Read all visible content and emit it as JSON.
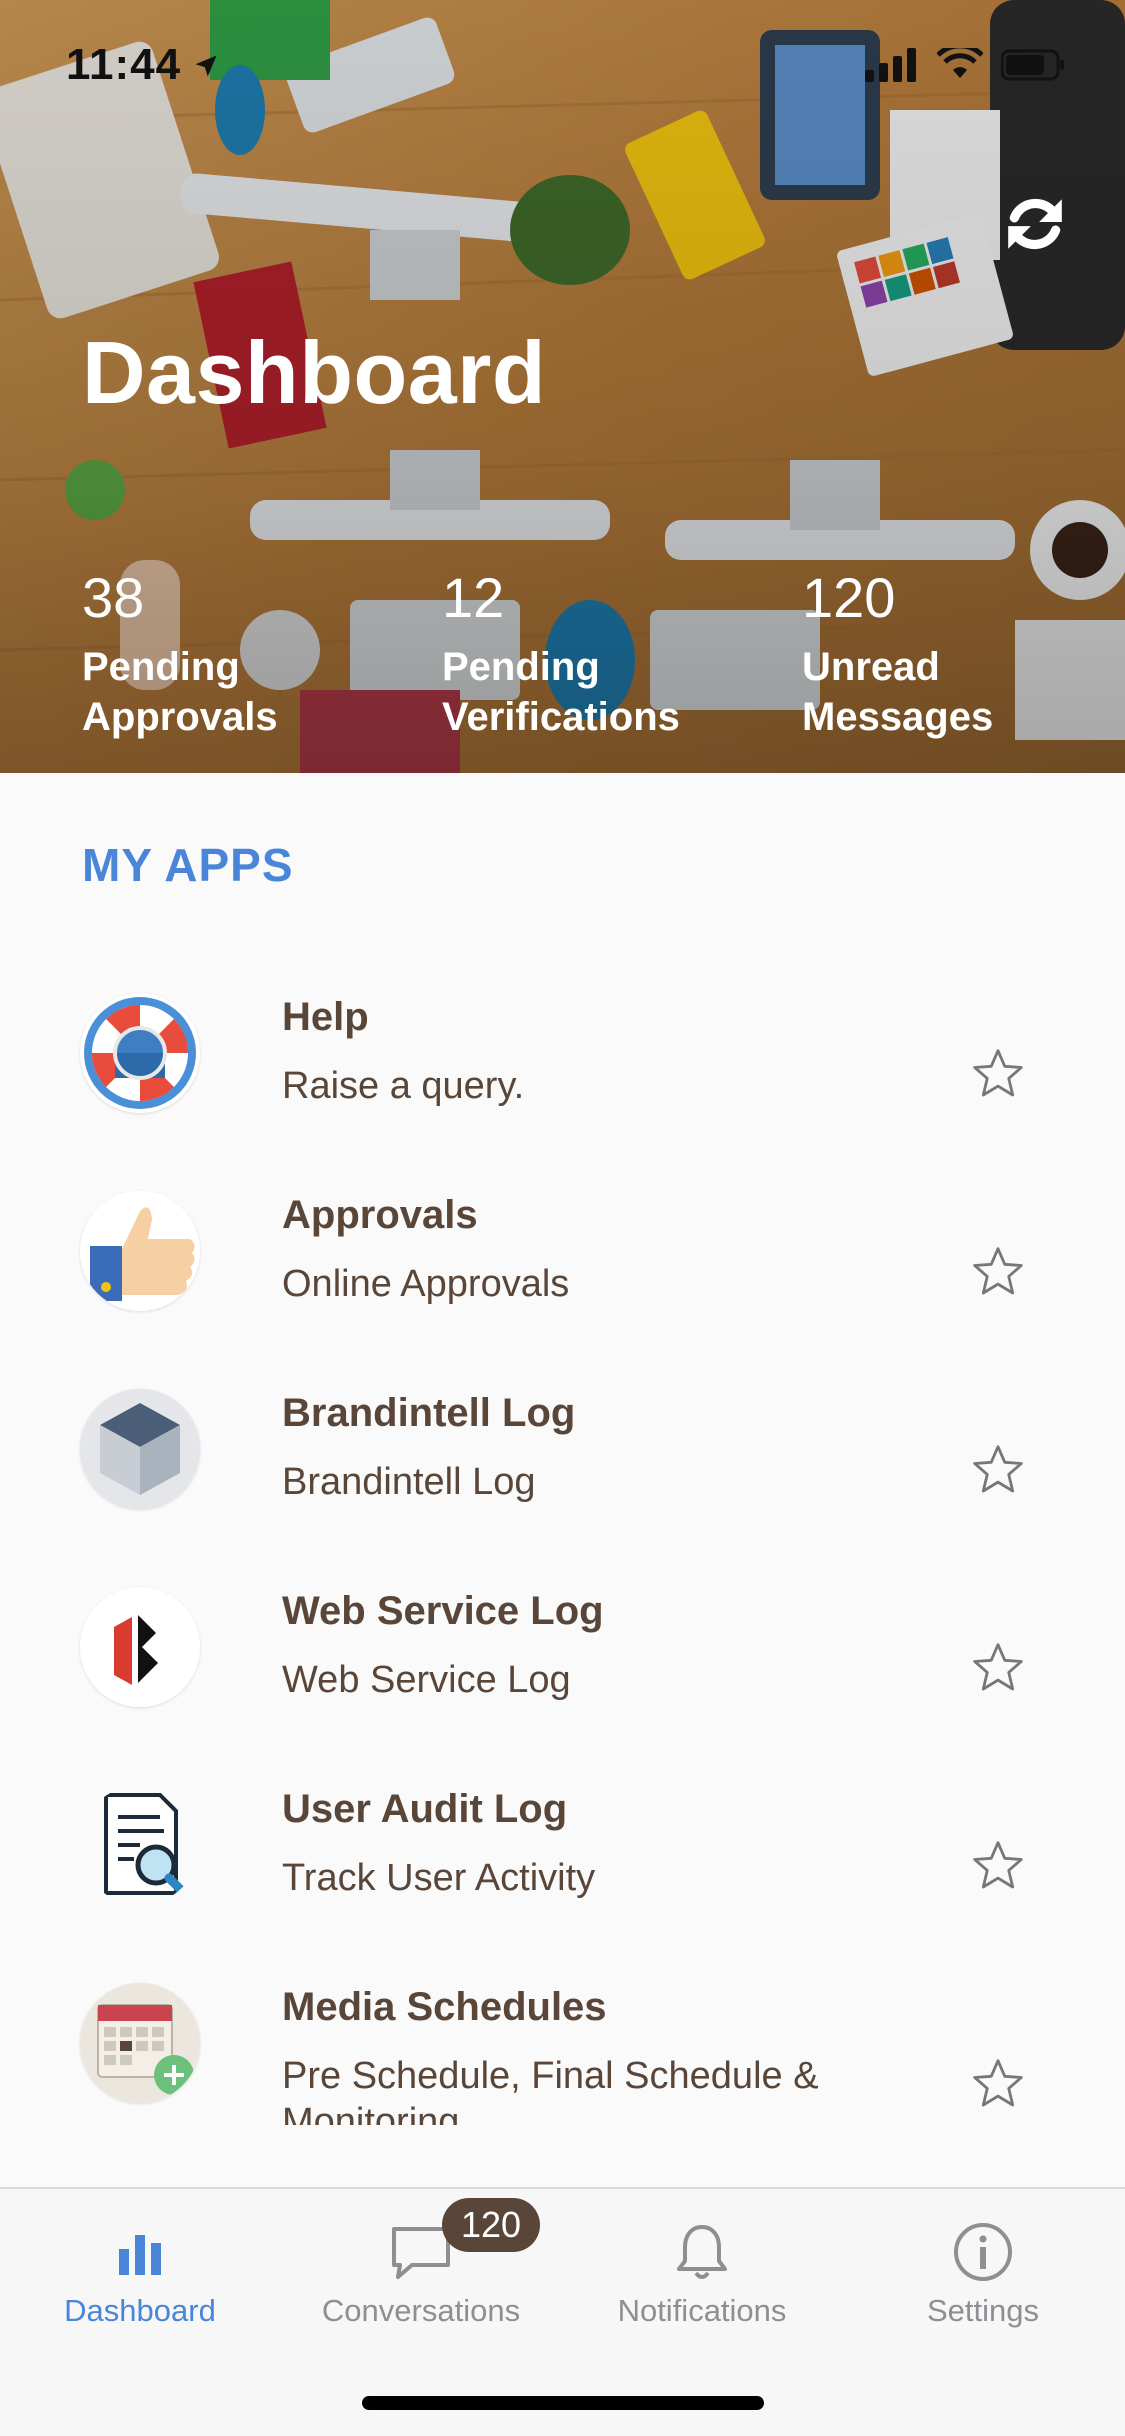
{
  "status_bar": {
    "time": "11:44"
  },
  "hero": {
    "title": "Dashboard",
    "stats": [
      {
        "value": "38",
        "label": "Pending Approvals"
      },
      {
        "value": "12",
        "label": "Pending Verifications"
      },
      {
        "value": "120",
        "label": "Unread Messages"
      }
    ]
  },
  "my_apps": {
    "heading": "MY APPS",
    "items": [
      {
        "title": "Help",
        "subtitle": "Raise a query.",
        "icon": "lifebuoy-icon"
      },
      {
        "title": "Approvals",
        "subtitle": "Online Approvals",
        "icon": "thumbs-up-icon"
      },
      {
        "title": "Brandintell Log",
        "subtitle": "Brandintell Log",
        "icon": "cube-icon"
      },
      {
        "title": "Web Service Log",
        "subtitle": "Web Service Log",
        "icon": "web-service-logo-icon"
      },
      {
        "title": "User Audit Log",
        "subtitle": "Track User Activity",
        "icon": "document-search-icon"
      },
      {
        "title": "Media Schedules",
        "subtitle": "Pre Schedule, Final Schedule & Monitoring",
        "icon": "calendar-add-icon"
      }
    ]
  },
  "tab_bar": {
    "tabs": [
      {
        "label": "Dashboard",
        "icon": "bar-chart-icon",
        "active": true
      },
      {
        "label": "Conversations",
        "icon": "chat-bubble-icon",
        "active": false
      },
      {
        "label": "Notifications",
        "icon": "bell-icon",
        "active": false
      },
      {
        "label": "Settings",
        "icon": "info-circle-icon",
        "active": false
      }
    ],
    "conversations_badge": "120"
  },
  "colors": {
    "accent": "#4a86d8",
    "text_brown": "#5a4638",
    "inactive_gray": "#8e8e93",
    "badge_bg": "#5a4638"
  }
}
